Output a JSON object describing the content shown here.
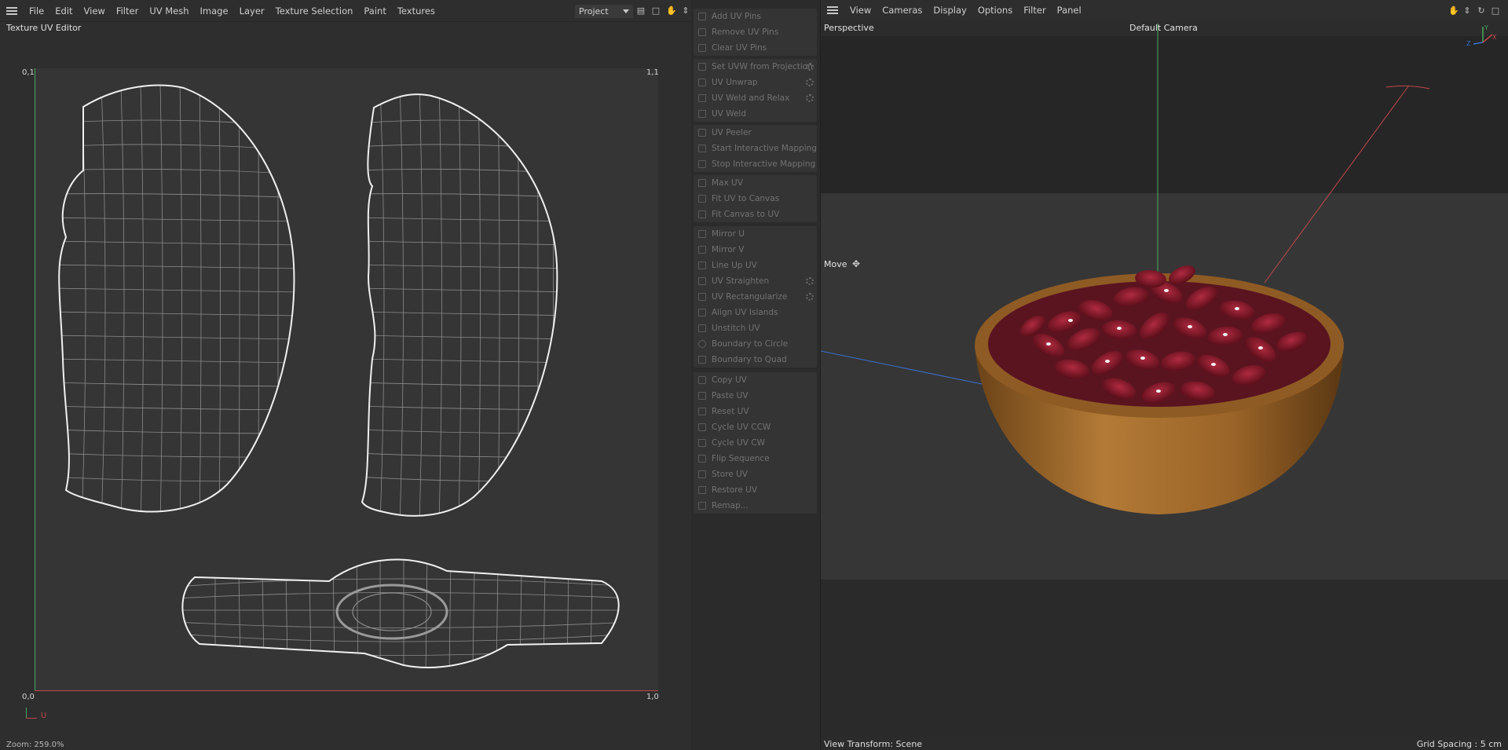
{
  "uv_editor": {
    "menu": [
      "File",
      "Edit",
      "View",
      "Filter",
      "UV Mesh",
      "Image",
      "Layer",
      "Texture Selection",
      "Paint",
      "Textures"
    ],
    "project_select": "Project",
    "title": "Texture UV Editor",
    "corners": {
      "top_left": "0,1",
      "top_right": "1,1",
      "bottom_left": "0,0",
      "bottom_right": "1,0"
    },
    "mini_axis_u": "U",
    "zoom": "Zoom: 259.0%"
  },
  "palette": {
    "groups": [
      [
        {
          "label": "Add UV Pins"
        },
        {
          "label": "Remove UV Pins"
        },
        {
          "label": "Clear UV Pins"
        }
      ],
      [
        {
          "label": "Set UVW from Projection",
          "gear": true
        },
        {
          "label": "UV Unwrap",
          "gear": true
        },
        {
          "label": "UV Weld and Relax",
          "gear": true
        },
        {
          "label": "UV Weld"
        }
      ],
      [
        {
          "label": "UV Peeler"
        },
        {
          "label": "Start Interactive Mapping"
        },
        {
          "label": "Stop Interactive Mapping"
        }
      ],
      [
        {
          "label": "Max UV"
        },
        {
          "label": "Fit UV to Canvas"
        },
        {
          "label": "Fit Canvas to UV"
        }
      ],
      [
        {
          "label": "Mirror U"
        },
        {
          "label": "Mirror V"
        },
        {
          "label": "Line Up UV"
        },
        {
          "label": "UV Straighten",
          "gear": true
        },
        {
          "label": "UV Rectangularize",
          "gear": true
        },
        {
          "label": "Align UV Islands"
        },
        {
          "label": "Unstitch UV"
        },
        {
          "label": "Boundary to Circle"
        },
        {
          "label": "Boundary to Quad"
        }
      ],
      [
        {
          "label": "Copy UV"
        },
        {
          "label": "Paste UV"
        },
        {
          "label": "Reset UV"
        },
        {
          "label": "Cycle UV CCW"
        },
        {
          "label": "Cycle UV CW"
        },
        {
          "label": "Flip Sequence"
        },
        {
          "label": "Store UV"
        },
        {
          "label": "Restore UV"
        },
        {
          "label": "Remap..."
        }
      ]
    ]
  },
  "viewport": {
    "menu": [
      "View",
      "Cameras",
      "Display",
      "Options",
      "Filter",
      "Panel"
    ],
    "projection": "Perspective",
    "camera": "Default Camera",
    "tool": "Move",
    "view_transform": "View Transform: Scene",
    "grid_spacing": "Grid Spacing : 5 cm",
    "gizmo_y": "Y",
    "gizmo_x": "X",
    "gizmo_z": "Z"
  },
  "colors": {
    "axis_u": "#c0474a",
    "axis_v": "#4aa861",
    "bowl": "#a0692c",
    "beans": "#8e1a2a"
  }
}
